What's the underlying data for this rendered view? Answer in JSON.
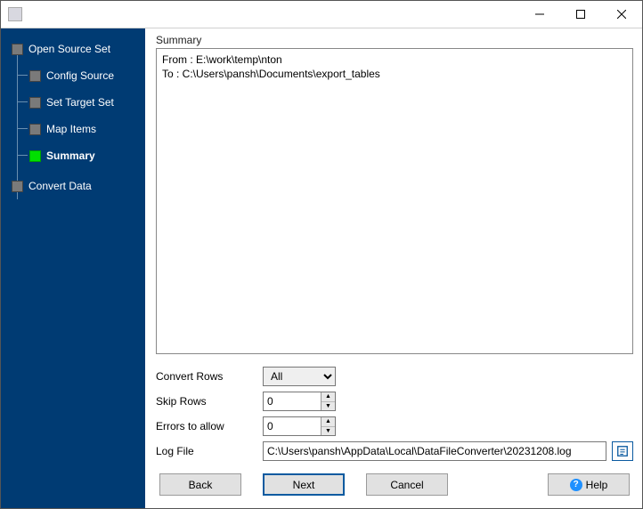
{
  "titlebar": {
    "title": ""
  },
  "sidebar": {
    "items": [
      {
        "label": "Open Source Set"
      },
      {
        "label": "Config Source"
      },
      {
        "label": "Set Target Set"
      },
      {
        "label": "Map Items"
      },
      {
        "label": "Summary"
      },
      {
        "label": "Convert Data"
      }
    ]
  },
  "main": {
    "summary_label": "Summary",
    "summary_lines": {
      "from": "From : E:\\work\\temp\\nton",
      "to": "To : C:\\Users\\pansh\\Documents\\export_tables"
    }
  },
  "options": {
    "convert_rows": {
      "label": "Convert Rows",
      "value": "All",
      "choices": [
        "All"
      ]
    },
    "skip_rows": {
      "label": "Skip Rows",
      "value": "0"
    },
    "errors_allow": {
      "label": "Errors to allow",
      "value": "0"
    },
    "log_file": {
      "label": "Log File",
      "value": "C:\\Users\\pansh\\AppData\\Local\\DataFileConverter\\20231208.log"
    }
  },
  "buttons": {
    "back": "Back",
    "next": "Next",
    "cancel": "Cancel",
    "help": "Help"
  }
}
